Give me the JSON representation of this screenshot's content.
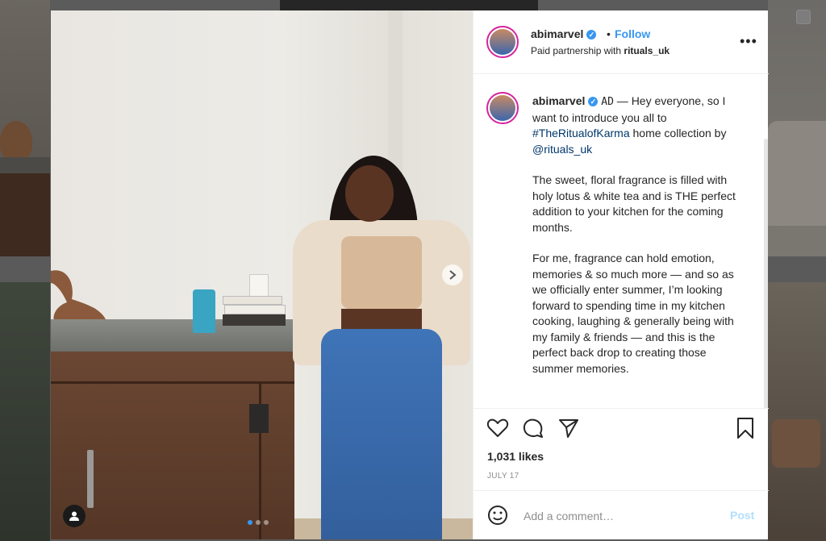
{
  "post": {
    "username": "abimarvel",
    "verified_icon": "verified-badge-icon",
    "dot": "•",
    "follow_label": "Follow",
    "partnership_prefix": "Paid partnership with ",
    "partner": "rituals_uk",
    "more_icon": "more-options-icon"
  },
  "caption": {
    "username": "abimarvel",
    "ad_tag": "AD",
    "line1": " — Hey everyone, so I want to introduce you all to ",
    "hashtag": "#TheRitualofKarma",
    "line1b": " home collection by ",
    "mention": "@rituals_uk",
    "para2": "The sweet, floral fragrance is filled with holy lotus & white tea and is THE perfect addition to your kitchen for the coming months.",
    "para3": "For me, fragrance can hold emotion, memories & so much more — and so as we officially enter summer, I’m looking forward to spending time in my kitchen cooking, laughing & generally being with my family & friends — and this is the perfect back drop to creating those summer memories."
  },
  "actions": {
    "like_icon": "heart-icon",
    "comment_icon": "comment-icon",
    "share_icon": "share-icon",
    "save_icon": "bookmark-icon"
  },
  "likes": "1,031 likes",
  "date": "JULY 17",
  "comment": {
    "placeholder": "Add a comment…",
    "post_label": "Post",
    "emoji_icon": "emoji-icon"
  },
  "carousel": {
    "current": 1,
    "total": 3
  },
  "colors": {
    "accent": "#3897f0",
    "post_disabled": "#b2dffc",
    "text": "#262626",
    "secondary": "#8e8e8e",
    "link": "#00376b"
  }
}
